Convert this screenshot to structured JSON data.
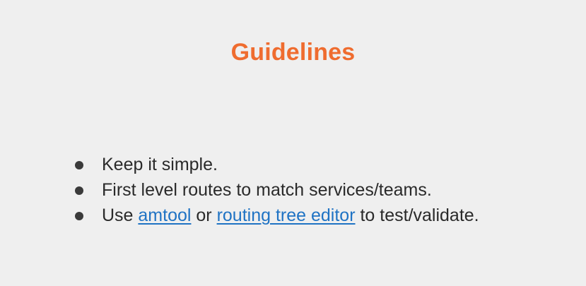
{
  "slide": {
    "title": "Guidelines",
    "colors": {
      "background": "#efefef",
      "title": "#ef6c2f",
      "text": "#2a2a2a",
      "link": "#1f73c4"
    },
    "bullets": [
      {
        "text": "Keep it simple."
      },
      {
        "text": "First level routes to match services/teams."
      },
      {
        "prefix": "Use ",
        "link1": "amtool",
        "middle": " or ",
        "link2": "routing tree editor",
        "suffix": " to test/validate."
      }
    ]
  }
}
